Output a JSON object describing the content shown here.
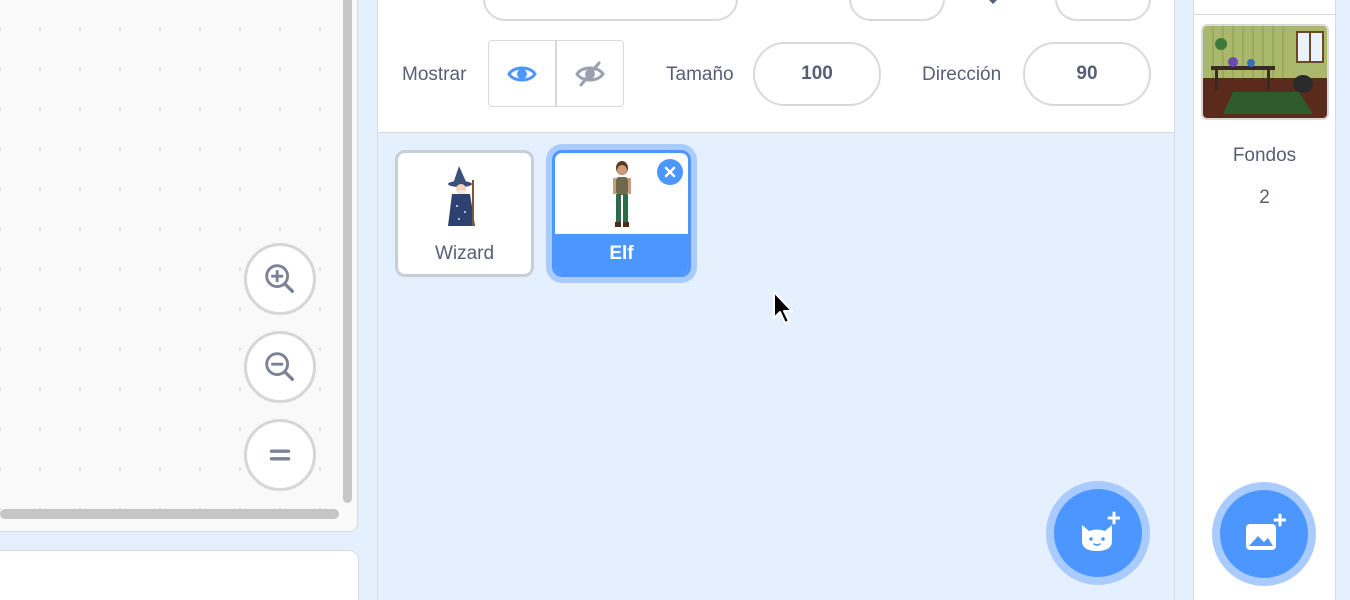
{
  "colors": {
    "accent": "#4c97ff",
    "accent_halo": "#a9cbff",
    "text": "#575e75",
    "list_bg": "#e5f0ff"
  },
  "code_area": {
    "zoom_in_icon": "zoom-in-icon",
    "zoom_out_icon": "zoom-out-icon",
    "zoom_reset_icon": "zoom-reset-icon"
  },
  "sprite_info": {
    "show_label": "Mostrar",
    "show_icon": "eye-icon",
    "hide_icon": "eye-slash-icon",
    "size_label": "Tamaño",
    "size_value": "100",
    "direction_label": "Dirección",
    "direction_value": "90"
  },
  "sprites": [
    {
      "name": "Wizard",
      "selected": false
    },
    {
      "name": "Elf",
      "selected": true
    }
  ],
  "stage": {
    "backdrops_label": "Fondos",
    "backdrops_count": "2"
  }
}
